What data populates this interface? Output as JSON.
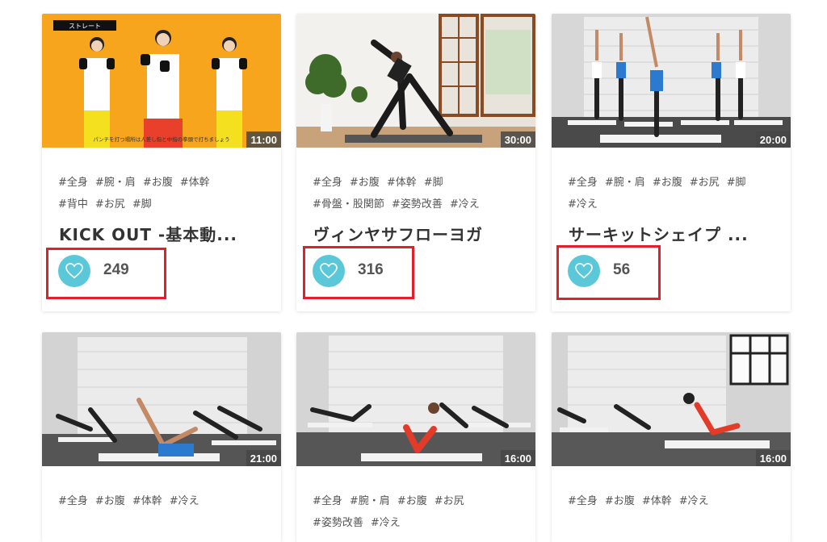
{
  "cards": [
    {
      "duration": "11:00",
      "thumb_caption": "ストレート",
      "thumb_subtitle": "パンチを打つ場所は人差し指と中指の拳頭で打ちましょう",
      "tags": [
        "#全身",
        "#腕・肩",
        "#お腹",
        "#体幹",
        "#背中",
        "#お尻",
        "#脚"
      ],
      "title": "KICK OUT -基本動...",
      "likes": "249"
    },
    {
      "duration": "30:00",
      "tags": [
        "#全身",
        "#お腹",
        "#体幹",
        "#脚",
        "#骨盤・股関節",
        "#姿勢改善",
        "#冷え"
      ],
      "title": "ヴィンヤサフローヨガ",
      "likes": "316"
    },
    {
      "duration": "20:00",
      "tags": [
        "#全身",
        "#腕・肩",
        "#お腹",
        "#お尻",
        "#脚",
        "#冷え"
      ],
      "title": "サーキットシェイプ ...",
      "likes": "56"
    },
    {
      "duration": "21:00",
      "tags": [
        "#全身",
        "#お腹",
        "#体幹",
        "#冷え"
      ]
    },
    {
      "duration": "16:00",
      "tags": [
        "#全身",
        "#腕・肩",
        "#お腹",
        "#お尻",
        "#姿勢改善",
        "#冷え"
      ]
    },
    {
      "duration": "16:00",
      "tags": [
        "#全身",
        "#お腹",
        "#体幹",
        "#冷え"
      ]
    }
  ],
  "colors": {
    "heart_button": "#5ac8d8",
    "highlight_box": "#e0202a",
    "thumb_1_bg": "#f7a51c"
  }
}
